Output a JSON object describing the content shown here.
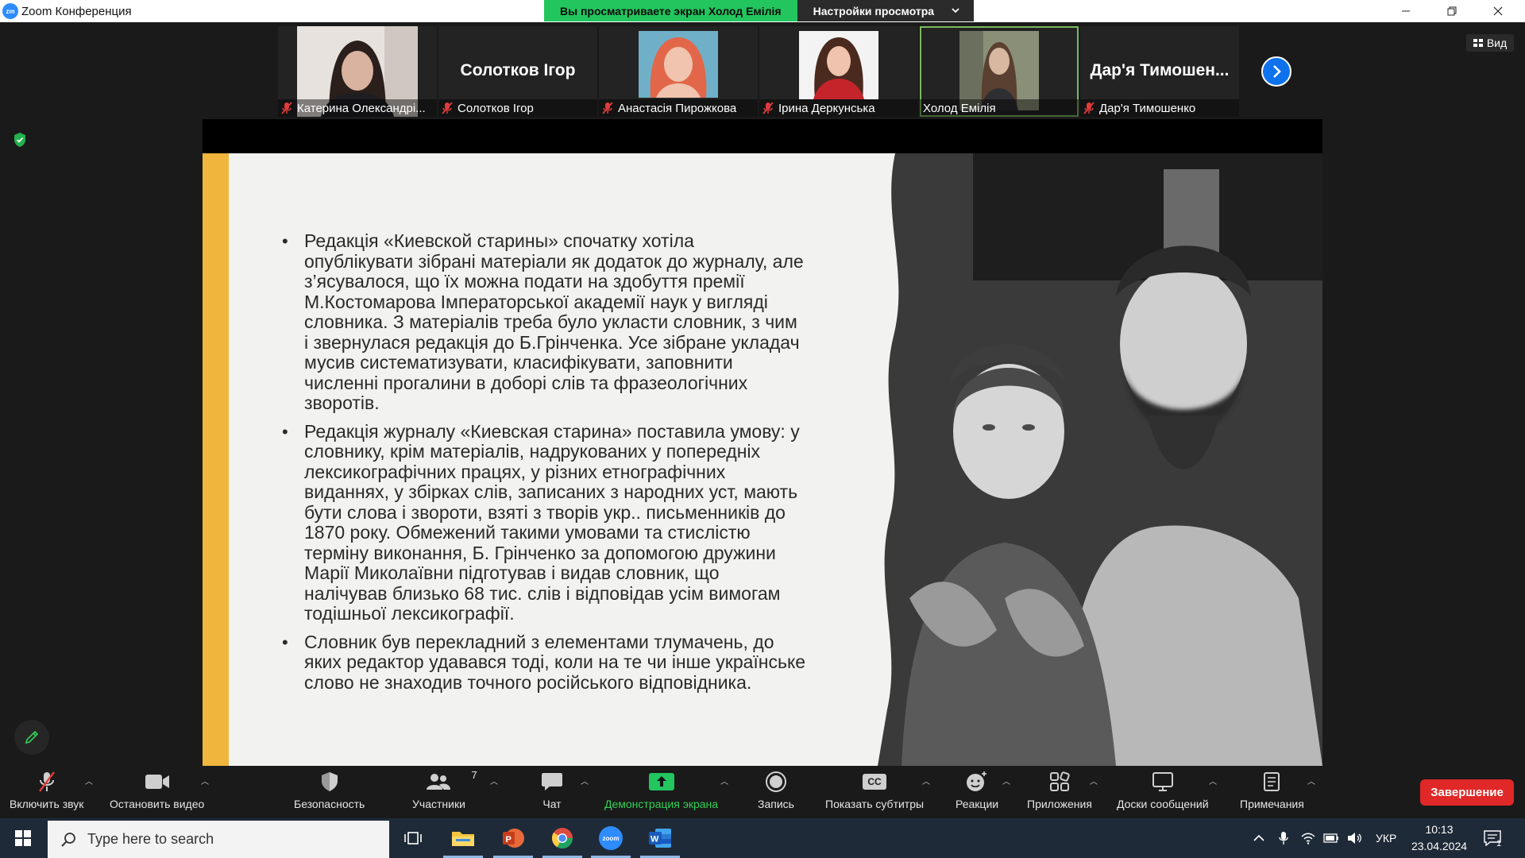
{
  "window": {
    "title": "Zoom Конференция",
    "logo_text": "zm"
  },
  "share_banner": {
    "viewing_label": "Вы просматриваете экран Холод Емілія",
    "view_settings_label": "Настройки просмотра"
  },
  "gallery": {
    "participants": [
      {
        "caption": "Катерина Олександрі...",
        "big_name": "",
        "has_video": true,
        "muted": true,
        "active": false
      },
      {
        "caption": "Солотков Ігор",
        "big_name": "Солотков Ігор",
        "has_video": false,
        "muted": true,
        "active": false
      },
      {
        "caption": "Анастасія Пирожкова",
        "big_name": "",
        "has_video": true,
        "muted": true,
        "active": false
      },
      {
        "caption": "Ірина Деркунська",
        "big_name": "",
        "has_video": true,
        "muted": true,
        "active": false
      },
      {
        "caption": "Холод Емілія",
        "big_name": "",
        "has_video": true,
        "muted": false,
        "active": true
      },
      {
        "caption": "Дар'я Тимошенко",
        "big_name": "Дар'я Тимошен...",
        "has_video": false,
        "muted": true,
        "active": false
      }
    ],
    "view_button_label": "Вид"
  },
  "slide": {
    "bullets": [
      " Редакція «Киевской старины» спочатку хотіла опублікувати зібрані матеріали як додаток до журналу, але з’ясувалося, що їх можна подати на здобуття премії М.Костомарова Імператорської академії наук у вигляді словника. З матеріалів треба було укласти словник, з чим і звернулася редакція до Б.Грінченка. Усе зібране укладач мусив систематизувати, класифікувати, заповнити численні прогалини в доборі слів та фразеологічних зворотів.",
      "Редакція журналу «Киевская старина» поставила умову: у словнику, крім матеріалів, надрукованих у попередніх лексикографічних працях, у різних етнографічних виданнях, у збірках слів, записаних з народних уст, мають бути слова і звороти, взяті з творів укр.. письменників до 1870 року. Обмежений такими умовами та стислістю терміну виконання, Б. Грінченко за допомогою дружини Марії Миколаївни підготував і видав  словник, що налічував близько 68 тис. слів і відповідав усім вимогам тодішньої лексикографії.",
      "Словник був перекладний з елементами тлумачень, до яких редактор удавався тоді, коли на те чи інше українське слово не знаходив точного російського відповідника."
    ],
    "accent_color": "#f0b53c"
  },
  "toolbar": {
    "unmute": "Включить звук",
    "stop_video": "Остановить видео",
    "security": "Безопасность",
    "participants": "Участники",
    "participants_count": "7",
    "chat": "Чат",
    "share_screen": "Демонстрация экрана",
    "record": "Запись",
    "captions": "Показать субтитры",
    "captions_icon_text": "CC",
    "reactions": "Реакции",
    "apps": "Приложения",
    "whiteboards": "Доски сообщений",
    "notes": "Примечания",
    "end": "Завершение"
  },
  "taskbar": {
    "search_placeholder": "Type here to search",
    "language": "УКР",
    "time": "10:13",
    "date": "23.04.2024",
    "notification_count": "1",
    "zoom_app_text": "zoom"
  },
  "colors": {
    "zoom_blue": "#2d8cff",
    "share_green": "#22c55e",
    "end_red": "#e02828",
    "taskbar": "#1f2a38"
  }
}
